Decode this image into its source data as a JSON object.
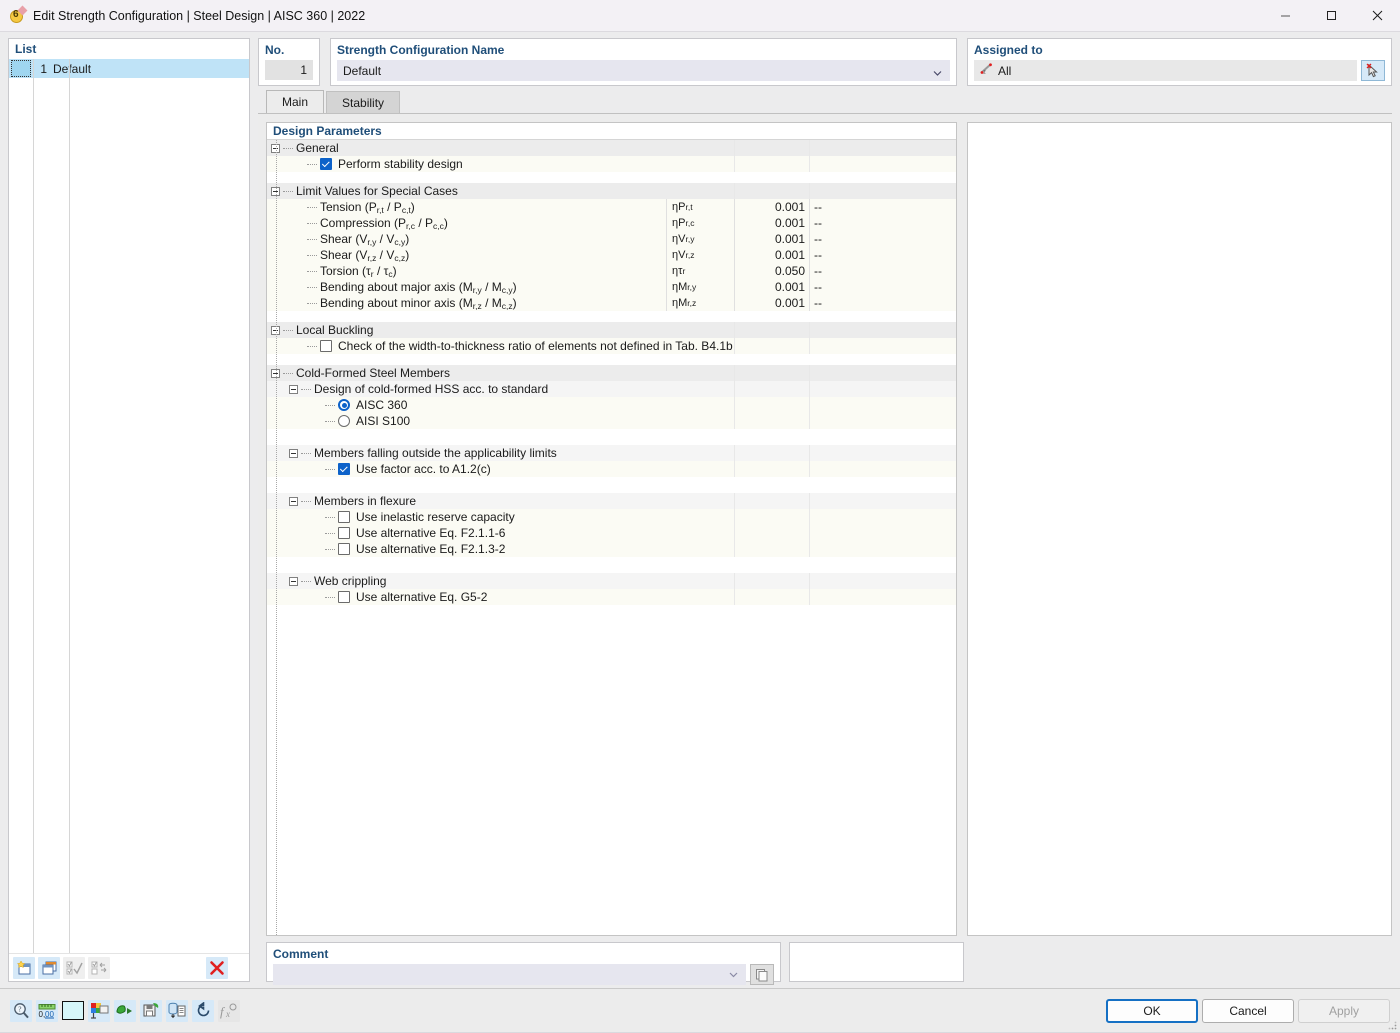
{
  "window": {
    "title": "Edit Strength Configuration | Steel Design | AISC 360 | 2022",
    "icon": "app-icon",
    "minimize": "—",
    "maximize": "□",
    "close": "✕"
  },
  "list_panel": {
    "header": "List",
    "rows": [
      {
        "no": "1",
        "name": "Default"
      }
    ],
    "toolbar": [
      {
        "name": "new-configuration-button",
        "label": "New"
      },
      {
        "name": "copy-configuration-button",
        "label": "Copy"
      },
      {
        "name": "select-all-button",
        "label": "Select All"
      },
      {
        "name": "invert-selection-button",
        "label": "Invert Selection"
      },
      {
        "name": "delete-configuration-button",
        "label": "Delete"
      }
    ]
  },
  "header": {
    "no_label": "No.",
    "no_value": "1",
    "name_label": "Strength Configuration Name",
    "name_value": "Default",
    "assigned_label": "Assigned to",
    "assigned_value": "All",
    "pick_button": "select-objects-button"
  },
  "tabs": [
    {
      "label": "Main",
      "active": true
    },
    {
      "label": "Stability",
      "active": false
    }
  ],
  "grid": {
    "title": "Design Parameters",
    "sections": [
      {
        "id": "general",
        "label": "General",
        "rows": [
          {
            "type": "checkbox",
            "label": "Perform stability design",
            "checked": true
          }
        ]
      },
      {
        "id": "limit-values",
        "label": "Limit Values for Special Cases",
        "rows": [
          {
            "type": "value",
            "label": "Tension (P",
            "sub1": "r,t",
            "mid": " / P",
            "sub2": "c,t",
            "tail": ")",
            "symbol": "ηPr,t",
            "value": "0.001",
            "unit": "--"
          },
          {
            "type": "value",
            "label": "Compression (P",
            "sub1": "r,c",
            "mid": " / P",
            "sub2": "c,c",
            "tail": ")",
            "symbol": "ηPr,c",
            "value": "0.001",
            "unit": "--"
          },
          {
            "type": "value",
            "label": "Shear (V",
            "sub1": "r,y",
            "mid": " / V",
            "sub2": "c,y",
            "tail": ")",
            "symbol": "ηVr,y",
            "value": "0.001",
            "unit": "--"
          },
          {
            "type": "value",
            "label": "Shear (V",
            "sub1": "r,z",
            "mid": " / V",
            "sub2": "c,z",
            "tail": ")",
            "symbol": "ηVr,z",
            "value": "0.001",
            "unit": "--"
          },
          {
            "type": "value",
            "label": "Torsion (τ",
            "sub1": "r",
            "mid": " / τ",
            "sub2": "c",
            "tail": ")",
            "symbol": "ητr",
            "value": "0.050",
            "unit": "--"
          },
          {
            "type": "value",
            "label": "Bending about major axis (M",
            "sub1": "r,y",
            "mid": " / M",
            "sub2": "c,y",
            "tail": ")",
            "symbol": "ηMr,y",
            "value": "0.001",
            "unit": "--"
          },
          {
            "type": "value",
            "label": "Bending about minor axis (M",
            "sub1": "r,z",
            "mid": " / M",
            "sub2": "c,z",
            "tail": ")",
            "symbol": "ηMr,z",
            "value": "0.001",
            "unit": "--"
          }
        ]
      },
      {
        "id": "local-buckling",
        "label": "Local Buckling",
        "rows": [
          {
            "type": "checkbox",
            "label": "Check of the width-to-thickness ratio of elements not defined in Tab. B4.1b",
            "checked": false
          }
        ]
      },
      {
        "id": "cold-formed",
        "label": "Cold-Formed Steel Members",
        "subgroups": [
          {
            "id": "hss-standard",
            "label": "Design of cold-formed HSS acc. to standard",
            "rows": [
              {
                "type": "radio",
                "label": "AISC 360",
                "checked": true
              },
              {
                "type": "radio",
                "label": "AISI S100",
                "checked": false
              }
            ]
          },
          {
            "id": "applicability-limits",
            "label": "Members falling outside the applicability limits",
            "rows": [
              {
                "type": "checkbox",
                "label": "Use factor acc. to A1.2(c)",
                "checked": true
              }
            ]
          },
          {
            "id": "members-in-flexure",
            "label": "Members in flexure",
            "rows": [
              {
                "type": "checkbox",
                "label": "Use inelastic reserve capacity",
                "checked": false
              },
              {
                "type": "checkbox",
                "label": "Use alternative Eq. F2.1.1-6",
                "checked": false
              },
              {
                "type": "checkbox",
                "label": "Use alternative Eq. F2.1.3-2",
                "checked": false
              }
            ]
          },
          {
            "id": "web-crippling",
            "label": "Web crippling",
            "rows": [
              {
                "type": "checkbox",
                "label": "Use alternative Eq. G5-2",
                "checked": false
              }
            ]
          }
        ]
      }
    ]
  },
  "comment": {
    "label": "Comment",
    "value": "",
    "placeholder": "",
    "copy_button": "copy-comment-button"
  },
  "footer_toolbar": [
    {
      "name": "info-search-icon"
    },
    {
      "name": "units-decimals-icon"
    },
    {
      "name": "color-swatch-icon"
    },
    {
      "name": "display-properties-icon"
    },
    {
      "name": "import-icon"
    },
    {
      "name": "export-icon"
    },
    {
      "name": "database-icon"
    },
    {
      "name": "reset-icon"
    },
    {
      "name": "formula-icon"
    }
  ],
  "footer_buttons": {
    "ok": "OK",
    "cancel": "Cancel",
    "apply": "Apply"
  },
  "colors": {
    "accent_label": "#1f4e79",
    "selection": "#bfe3f7",
    "checkbox_on": "#0d62c9",
    "delete": "#e02020",
    "primary_border": "#1570c4"
  }
}
